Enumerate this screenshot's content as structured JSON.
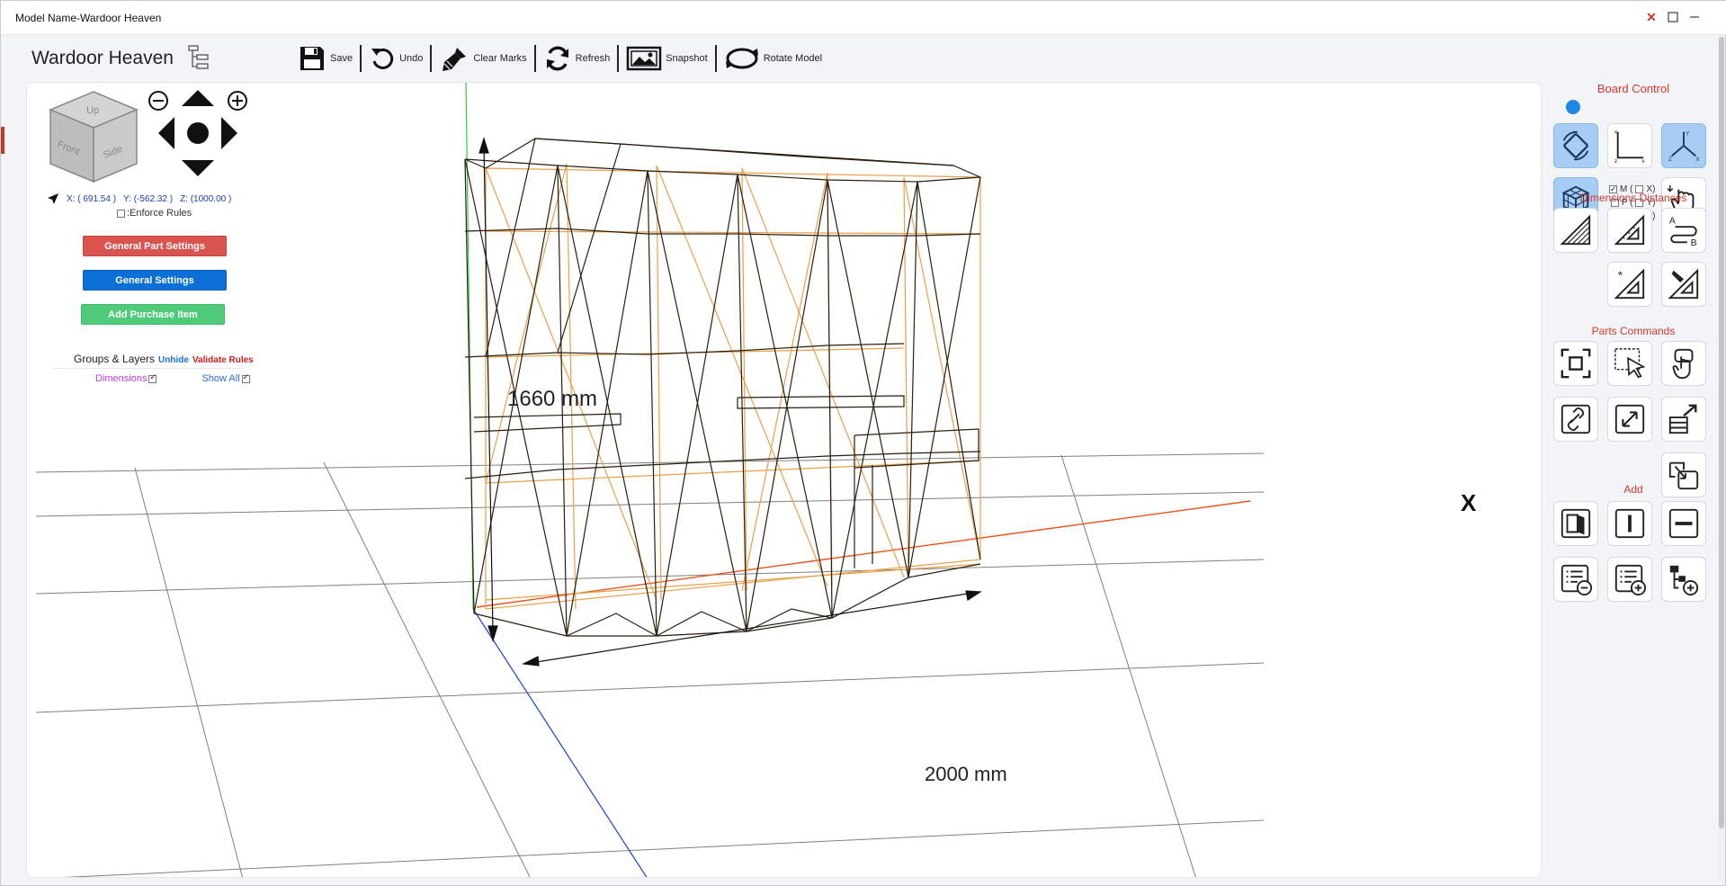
{
  "window": {
    "title": "Model Name-Wardoor Heaven"
  },
  "header": {
    "app_name": "Wardoor Heaven"
  },
  "toolbar": {
    "save": "Save",
    "undo": "Undo",
    "clear_marks": "Clear Marks",
    "refresh": "Refresh",
    "snapshot": "Snapshot",
    "rotate_model": "Rotate Model"
  },
  "view": {
    "cube": {
      "up": "Up",
      "front": "Front",
      "side": "Side"
    },
    "coords": {
      "x": "X: ( 691.54 )",
      "y": "Y: (-562.32 )",
      "z": "Z: (1000.00 )"
    },
    "enforce_rules": ":Enforce Rules",
    "buttons": {
      "general_part_settings": "General Part Settings",
      "general_settings": "General Settings",
      "add_purchase_item": "Add Purchase Item"
    },
    "groups": {
      "title": "Groups & Layers",
      "unhide": "Unhide",
      "validate": "Validate Rules"
    },
    "toggles": {
      "dimensions": "Dimensions",
      "show_all": "Show All"
    },
    "dimension_labels": {
      "height": "1660 mm",
      "width": "2000 mm"
    },
    "marker_label": "X"
  },
  "right_panel": {
    "board_control": "Board Control",
    "axis": {
      "m": "M (",
      "x": "X)",
      "p": "P (",
      "y": "Y)",
      "z_open": "(",
      "z": "Z)"
    },
    "dimensions_distances": "Dimensions Distances",
    "parts_commands": "Parts Commands",
    "add": "Add",
    "dim_ab_a": "A",
    "dim_ab_b": "B"
  },
  "colors": {
    "accent_red": "#d0392b",
    "active_blue": "#a8cdf4",
    "frame_orange": "#e8a04a",
    "frame_dark": "#2b1d0e"
  }
}
